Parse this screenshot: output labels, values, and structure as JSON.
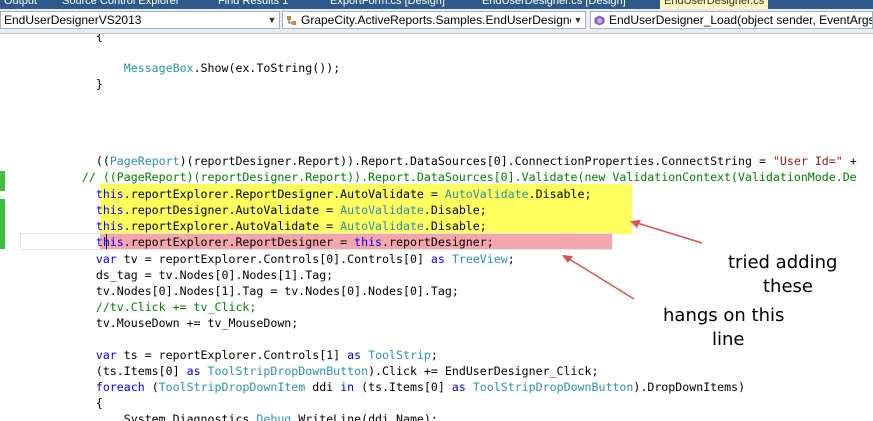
{
  "tabs": [
    {
      "label": "Output",
      "active": false
    },
    {
      "label": "Source Control Explorer",
      "active": false
    },
    {
      "label": "Find Results 1",
      "active": false
    },
    {
      "label": "ExportForm.cs [Design]",
      "active": false
    },
    {
      "label": "EndUserDesigner.cs [Design]",
      "active": false
    },
    {
      "label": "EndUserDesigner.cs",
      "active": true
    }
  ],
  "navbar": {
    "project": "EndUserDesignerVS2013",
    "class_member": "GrapeCity.ActiveReports.Samples.EndUserDesigner.En",
    "method": "EndUserDesigner_Load(object sender, EventArgs e)"
  },
  "colors": {
    "yellow_highlight": "#ffff5e",
    "red_highlight": "#f4a6ad",
    "change_margin": "#40c040",
    "arrow": "#d9534f"
  },
  "code": [
    [
      {
        "t": "p",
        "v": "        {"
      }
    ],
    [
      {
        "t": "p",
        "v": ""
      }
    ],
    [
      {
        "t": "p",
        "v": "            "
      },
      {
        "t": "t",
        "v": "MessageBox"
      },
      {
        "t": "p",
        "v": ".Show(ex.ToString());"
      }
    ],
    [
      {
        "t": "p",
        "v": "        }"
      }
    ],
    [
      {
        "t": "p",
        "v": ""
      }
    ],
    [
      {
        "t": "p",
        "v": ""
      }
    ],
    [
      {
        "t": "p",
        "v": ""
      }
    ],
    [
      {
        "t": "p",
        "v": ""
      }
    ],
    [
      {
        "t": "p",
        "v": "        (("
      },
      {
        "t": "t",
        "v": "PageReport"
      },
      {
        "t": "p",
        "v": ")(reportDesigner.Report)).Report.DataSources[0].ConnectionProperties.ConnectString = "
      },
      {
        "t": "s",
        "v": "\"User Id=\""
      },
      {
        "t": "p",
        "v": " +"
      }
    ],
    [
      {
        "t": "c",
        "v": "      // ((PageReport)(reportDesigner.Report)).Report.DataSources[0].Validate(new ValidationContext(ValidationMode.De"
      }
    ],
    [
      {
        "t": "p",
        "v": "        "
      },
      {
        "t": "k",
        "v": "this"
      },
      {
        "t": "p",
        "v": ".reportExplorer.ReportDesigner.AutoValidate = "
      },
      {
        "t": "t",
        "v": "AutoValidate"
      },
      {
        "t": "p",
        "v": ".Disable;"
      }
    ],
    [
      {
        "t": "p",
        "v": "        "
      },
      {
        "t": "k",
        "v": "this"
      },
      {
        "t": "p",
        "v": ".reportDesigner.AutoValidate = "
      },
      {
        "t": "t",
        "v": "AutoValidate"
      },
      {
        "t": "p",
        "v": ".Disable;"
      }
    ],
    [
      {
        "t": "p",
        "v": "        "
      },
      {
        "t": "k",
        "v": "this"
      },
      {
        "t": "p",
        "v": ".reportExplorer.AutoValidate = "
      },
      {
        "t": "t",
        "v": "AutoValidate"
      },
      {
        "t": "p",
        "v": ".Disable;"
      }
    ],
    [
      {
        "t": "p",
        "v": "        "
      },
      {
        "t": "k",
        "v": "this"
      },
      {
        "t": "p",
        "v": ".reportExplorer.ReportDesigner = "
      },
      {
        "t": "k",
        "v": "this"
      },
      {
        "t": "p",
        "v": ".reportDesigner;"
      }
    ],
    [
      {
        "t": "p",
        "v": "        "
      },
      {
        "t": "k",
        "v": "var"
      },
      {
        "t": "p",
        "v": " tv = reportExplorer.Controls[0].Controls[0] "
      },
      {
        "t": "k",
        "v": "as"
      },
      {
        "t": "p",
        "v": " "
      },
      {
        "t": "t",
        "v": "TreeView"
      },
      {
        "t": "p",
        "v": ";"
      }
    ],
    [
      {
        "t": "p",
        "v": "        ds_tag = tv.Nodes[0].Nodes[1].Tag;"
      }
    ],
    [
      {
        "t": "p",
        "v": "        tv.Nodes[0].Nodes[1].Tag = tv.Nodes[0].Nodes[0].Tag;"
      }
    ],
    [
      {
        "t": "c",
        "v": "        //tv.Click += tv_Click;"
      }
    ],
    [
      {
        "t": "p",
        "v": "        tv.MouseDown += tv_MouseDown;"
      }
    ],
    [
      {
        "t": "p",
        "v": ""
      }
    ],
    [
      {
        "t": "p",
        "v": "        "
      },
      {
        "t": "k",
        "v": "var"
      },
      {
        "t": "p",
        "v": " ts = reportExplorer.Controls[1] "
      },
      {
        "t": "k",
        "v": "as"
      },
      {
        "t": "p",
        "v": " "
      },
      {
        "t": "t",
        "v": "ToolStrip"
      },
      {
        "t": "p",
        "v": ";"
      }
    ],
    [
      {
        "t": "p",
        "v": "        (ts.Items[0] "
      },
      {
        "t": "k",
        "v": "as"
      },
      {
        "t": "p",
        "v": " "
      },
      {
        "t": "t",
        "v": "ToolStripDropDownButton"
      },
      {
        "t": "p",
        "v": ").Click += EndUserDesigner_Click;"
      }
    ],
    [
      {
        "t": "p",
        "v": "        "
      },
      {
        "t": "k",
        "v": "foreach"
      },
      {
        "t": "p",
        "v": " ("
      },
      {
        "t": "t",
        "v": "ToolStripDropDownItem"
      },
      {
        "t": "p",
        "v": " ddi "
      },
      {
        "t": "k",
        "v": "in"
      },
      {
        "t": "p",
        "v": " (ts.Items[0] "
      },
      {
        "t": "k",
        "v": "as"
      },
      {
        "t": "p",
        "v": " "
      },
      {
        "t": "t",
        "v": "ToolStripDropDownButton"
      },
      {
        "t": "p",
        "v": ").DropDownItems)"
      }
    ],
    [
      {
        "t": "p",
        "v": "        {"
      }
    ],
    [
      {
        "t": "p",
        "v": "            System.Diagnostics."
      },
      {
        "t": "t",
        "v": "Debug"
      },
      {
        "t": "p",
        "v": ".WriteLine(ddi.Name);"
      }
    ]
  ],
  "annotations": {
    "tried_line1": "tried adding",
    "tried_line2": "these",
    "hangs_line1": "hangs on this",
    "hangs_line2": "line"
  }
}
